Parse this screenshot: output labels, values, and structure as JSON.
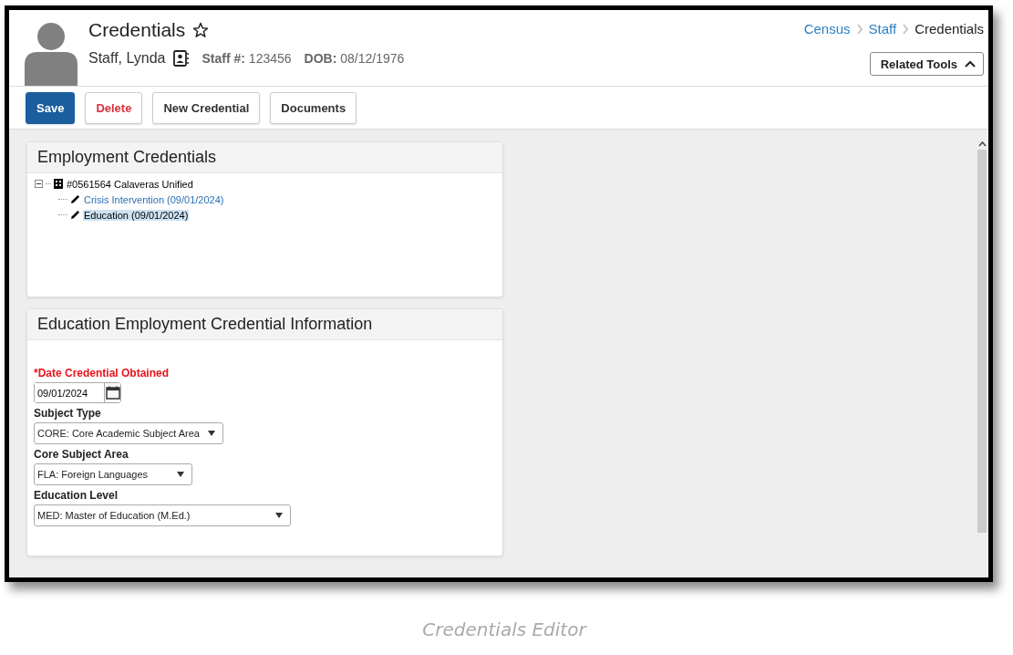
{
  "header": {
    "title": "Credentials",
    "favorite": false,
    "person_name": "Staff, Lynda",
    "staff_label": "Staff #:",
    "staff_number": "123456",
    "dob_label": "DOB:",
    "dob": "08/12/1976",
    "breadcrumbs": [
      {
        "label": "Census",
        "kind": "link"
      },
      {
        "label": "Staff",
        "kind": "link"
      },
      {
        "label": "Credentials",
        "kind": "current"
      }
    ],
    "related_tools": {
      "label": "Related Tools",
      "expanded": true
    }
  },
  "toolbar": [
    {
      "label": "Save",
      "kind": "primary"
    },
    {
      "label": "Delete",
      "kind": "danger"
    },
    {
      "label": "New Credential",
      "kind": "default"
    },
    {
      "label": "Documents",
      "kind": "default"
    }
  ],
  "credentials_panel": {
    "title": "Employment Credentials",
    "tree": [
      {
        "label": "#0561564 Calaveras Unified",
        "expanded": true,
        "selected": false,
        "children": [
          {
            "label": "Crisis Intervention (09/01/2024)",
            "selected": false
          },
          {
            "label": "Education (09/01/2024)",
            "selected": true
          }
        ]
      }
    ]
  },
  "info_panel": {
    "title": "Education Employment Credential Information",
    "required_mark": "*",
    "fields": [
      {
        "kind": "date",
        "label": "Date Credential Obtained",
        "required": true,
        "value": "09/01/2024"
      },
      {
        "kind": "select",
        "label": "Subject Type",
        "required": false,
        "value": "CORE: Core Academic Subject Area"
      },
      {
        "kind": "select",
        "label": "Core Subject Area",
        "required": false,
        "value": "FLA: Foreign Languages"
      },
      {
        "kind": "select",
        "label": "Education Level",
        "required": false,
        "value": "MED: Master of Education (M.Ed.)"
      }
    ]
  },
  "caption": "Credentials Editor"
}
